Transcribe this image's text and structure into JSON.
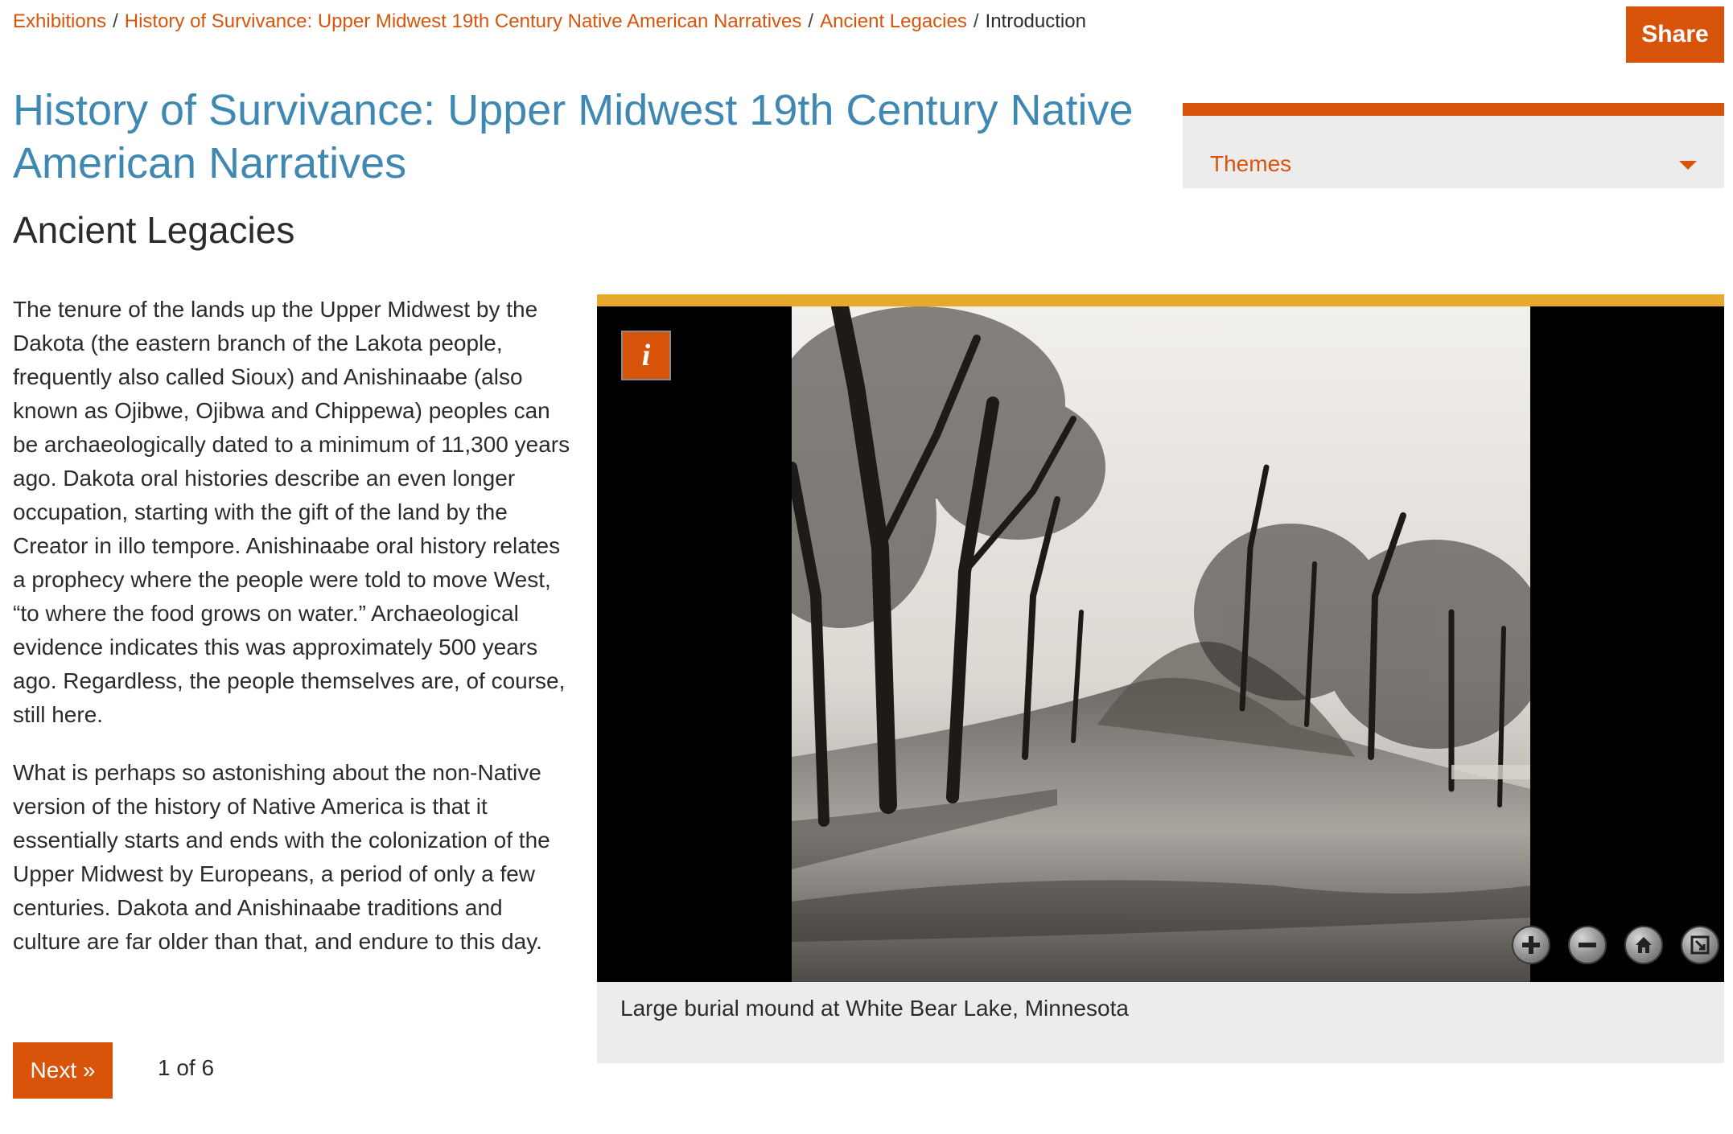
{
  "breadcrumb": {
    "items": [
      {
        "label": "Exhibitions"
      },
      {
        "label": "History of Survivance: Upper Midwest 19th Century Native American Narratives"
      },
      {
        "label": "Ancient Legacies"
      }
    ],
    "current": "Introduction",
    "separator": "/"
  },
  "header": {
    "share_label": "Share",
    "title": "History of Survivance: Upper Midwest 19th Century Native American Narratives"
  },
  "themes": {
    "label": "Themes",
    "icon": "caret-down-icon"
  },
  "section": {
    "title": "Ancient Legacies",
    "paragraphs": [
      "The tenure of the lands up the Upper Midwest by the Dakota (the eastern branch of the Lakota people, frequently also called Sioux) and Anishinaabe (also known as Ojibwe, Ojibwa and Chippewa) peoples can be archaeologically dated to a minimum of 11,300 years ago. Dakota oral histories describe an even longer occupation, starting with the gift of the land by the Creator in illo tempore. Anishinaabe oral history relates a prophecy where the people were told to move West, “to where the food grows on water.” Archaeological evidence indicates this was approximately 500 years ago. Regardless, the people themselves are, of course, still here.",
      "What is perhaps so astonishing about the non-Native version of the history of Native America is that it essentially starts and ends with the colonization of the Upper Midwest by Europeans, a period of only a few centuries. Dakota and Anishinaabe traditions and culture are far older than that, and endure to this day."
    ]
  },
  "viewer": {
    "info_label": "i",
    "caption": "Large burial mound at White Bear Lake, Minnesota",
    "controls": [
      "zoom-in-icon",
      "zoom-out-icon",
      "home-icon",
      "fullscreen-icon"
    ]
  },
  "pagination": {
    "next_label": "Next »",
    "counter": "1 of 6"
  },
  "colors": {
    "accent": "#d9540b",
    "title_blue": "#3f88b4",
    "viewer_bar": "#e8a82b",
    "panel_bg": "#ececec"
  }
}
